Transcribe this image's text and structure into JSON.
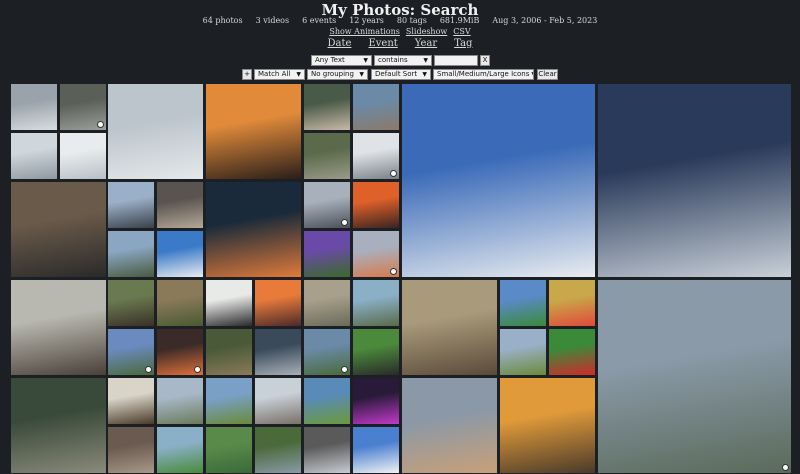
{
  "header": {
    "title": "My Photos: Search",
    "stats": {
      "photos": "64 photos",
      "videos": "3 videos",
      "events": "6 events",
      "years": "12 years",
      "tags": "80 tags",
      "size": "681.9MiB",
      "range": "Aug 3, 2006 - Feb 5, 2023"
    },
    "links": {
      "animations": "Show Animations",
      "slideshow": "Slideshow",
      "csv": "CSV"
    },
    "views": {
      "date": "Date",
      "event": "Event",
      "year": "Year",
      "tag": "Tag"
    }
  },
  "filters": {
    "row1": {
      "field": "Any Text",
      "operator": "contains",
      "value": "",
      "clear_row": "X"
    },
    "row2": {
      "add": "+",
      "match": "Match All",
      "grouping": "No grouping",
      "sort": "Default Sort",
      "size": "Small/Medium/Large Icons",
      "clear": "Clear"
    }
  },
  "icons": {
    "dropdown": "chevron-down-icon",
    "video_badge": "video-icon"
  },
  "photos": [
    {
      "colors": [
        "#9aa3ab",
        "#d9dde0"
      ],
      "video": false
    },
    {
      "colors": [
        "#5a6058",
        "#9aa09a"
      ],
      "video": true
    },
    {
      "colors": [
        "#cfd6dc",
        "#8f98a0"
      ],
      "video": false
    },
    {
      "colors": [
        "#e8ecee",
        "#b8bfc4"
      ],
      "video": false
    },
    {
      "colors": [
        "#bcc4cc",
        "#e4e8ea"
      ],
      "video": false
    },
    {
      "colors": [
        "#e08a3a",
        "#2a1e1a"
      ],
      "video": false
    },
    {
      "colors": [
        "#4a5a48",
        "#c8b8a8"
      ],
      "video": false
    },
    {
      "colors": [
        "#6a8aa8",
        "#8a7a6a"
      ],
      "video": false
    },
    {
      "colors": [
        "#5a6a4a",
        "#9a9a8a"
      ],
      "video": false
    },
    {
      "colors": [
        "#dfe3e6",
        "#7a8088"
      ],
      "video": true
    },
    {
      "colors": [
        "#3a6ab8",
        "#e8ecf0"
      ],
      "video": false
    },
    {
      "colors": [
        "#2a3a5a",
        "#c8d0d8"
      ],
      "video": false
    },
    {
      "colors": [
        "#6a5a4a",
        "#2a2a2a"
      ],
      "video": false
    },
    {
      "colors": [
        "#9ab0c8",
        "#3a4048"
      ],
      "video": false
    },
    {
      "colors": [
        "#5a5450",
        "#b4a898"
      ],
      "video": false
    },
    {
      "colors": [
        "#8aa6c2",
        "#4a5a40"
      ],
      "video": false
    },
    {
      "colors": [
        "#3a7ac8",
        "#e8ecf0"
      ],
      "video": false
    },
    {
      "colors": [
        "#1a2a3a",
        "#e07a3a"
      ],
      "video": false
    },
    {
      "colors": [
        "#a8b0bc",
        "#4a5058"
      ],
      "video": true
    },
    {
      "colors": [
        "#e0602a",
        "#3a2420"
      ],
      "video": false
    },
    {
      "colors": [
        "#6a4aa8",
        "#3a6a2a"
      ],
      "video": false
    },
    {
      "colors": [
        "#a8b0c0",
        "#d87a4a"
      ],
      "video": true
    },
    {
      "colors": [
        "#b8b8b0",
        "#4a4038"
      ],
      "video": false
    },
    {
      "colors": [
        "#6a7a50",
        "#3a3028"
      ],
      "video": false
    },
    {
      "colors": [
        "#8a7a5a",
        "#4a5a30"
      ],
      "video": false
    },
    {
      "colors": [
        "#e8eae8",
        "#2a2a2a"
      ],
      "video": false
    },
    {
      "colors": [
        "#e87a3a",
        "#4a2a2a"
      ],
      "video": false
    },
    {
      "colors": [
        "#a8a08a",
        "#6a6a5a"
      ],
      "video": false
    },
    {
      "colors": [
        "#8ab0c8",
        "#5a6a4a"
      ],
      "video": false
    },
    {
      "colors": [
        "#6a8ac0",
        "#4a6a3a"
      ],
      "video": true
    },
    {
      "colors": [
        "#3a2a28",
        "#e0703a"
      ],
      "video": true
    },
    {
      "colors": [
        "#4a5a38",
        "#8a7a5a"
      ],
      "video": false
    },
    {
      "colors": [
        "#3a4a5a",
        "#a8b0b8"
      ],
      "video": false
    },
    {
      "colors": [
        "#6a8aa8",
        "#4a6a3a"
      ],
      "video": true
    },
    {
      "colors": [
        "#4a8a3a",
        "#2a2a2a"
      ],
      "video": false
    },
    {
      "colors": [
        "#a89a7a",
        "#5a4a3a"
      ],
      "video": false
    },
    {
      "colors": [
        "#5a8ac8",
        "#3a8a3a"
      ],
      "video": false
    },
    {
      "colors": [
        "#c8a84a",
        "#e04a3a"
      ],
      "video": false
    },
    {
      "colors": [
        "#9ab0c8",
        "#6a8a3a"
      ],
      "video": false
    },
    {
      "colors": [
        "#3a8a3a",
        "#d02a2a"
      ],
      "video": false
    },
    {
      "colors": [
        "#8a9aa8",
        "#5a6a5a"
      ],
      "video": true
    },
    {
      "colors": [
        "#3a4a3a",
        "#8a8a7a"
      ],
      "video": false
    },
    {
      "colors": [
        "#d8d4c8",
        "#4a3a2a"
      ],
      "video": false
    },
    {
      "colors": [
        "#a8b8c8",
        "#6a7a5a"
      ],
      "video": false
    },
    {
      "colors": [
        "#7aa0c8",
        "#6a8a3a"
      ],
      "video": false
    },
    {
      "colors": [
        "#c8d0d8",
        "#7a7068"
      ],
      "video": false
    },
    {
      "colors": [
        "#5a8ab8",
        "#6a9a3a"
      ],
      "video": false
    },
    {
      "colors": [
        "#2a1a3a",
        "#c03ac8"
      ],
      "video": false
    },
    {
      "colors": [
        "#6a5a50",
        "#a89888"
      ],
      "video": false
    },
    {
      "colors": [
        "#8ab0c8",
        "#4a8a3a"
      ],
      "video": false
    },
    {
      "colors": [
        "#5a8a4a",
        "#3a6a3a"
      ],
      "video": false
    },
    {
      "colors": [
        "#4a6a3a",
        "#8a9aa8"
      ],
      "video": false
    },
    {
      "colors": [
        "#5a5a5a",
        "#c8ccd0"
      ],
      "video": false
    },
    {
      "colors": [
        "#4a80d0",
        "#f0f2f4"
      ],
      "video": false
    },
    {
      "colors": [
        "#8a98a8",
        "#c8a078"
      ],
      "video": false
    },
    {
      "colors": [
        "#e09a3a",
        "#4a3a2a"
      ],
      "video": false
    },
    {
      "colors": [
        "#a87a4a",
        "#e8e0d0"
      ],
      "video": false
    },
    {
      "colors": [
        "#6a8a4a",
        "#3a3a3a"
      ],
      "video": false
    },
    {
      "colors": [
        "#3a5a2a",
        "#e8e8e8"
      ],
      "video": false
    },
    {
      "colors": [
        "#3a3a3a",
        "#e8e8e8"
      ],
      "video": false
    }
  ]
}
